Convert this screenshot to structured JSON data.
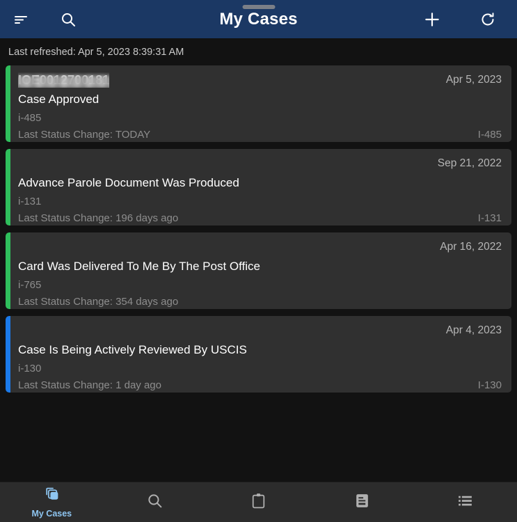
{
  "appbar": {
    "title": "My Cases",
    "sort_icon": "sort-icon",
    "search_icon": "search-icon",
    "add_icon": "plus-icon",
    "refresh_icon": "refresh-icon"
  },
  "refreshed": {
    "text": "Last refreshed: Apr 5, 2023 8:39:31 AM"
  },
  "colors": {
    "appbar_bg": "#1b3864",
    "page_bg": "#121212",
    "card_bg": "#303030",
    "accent_green": "#2fbf5c",
    "accent_blue": "#1b7aea",
    "active_nav": "#8ec5f0"
  },
  "cards": [
    {
      "case_number": "IOE0012700181",
      "redacted": true,
      "redact_width": 160,
      "date": "Apr 5, 2023",
      "status": "Case Approved",
      "form": "i-485",
      "last_status_change": "Last Status Change: TODAY",
      "form_right": "I-485",
      "accent": "#2fbf5c"
    },
    {
      "case_number": "",
      "redacted": true,
      "redact_width": 150,
      "date": "Sep 21, 2022",
      "status": "Advance Parole Document Was Produced",
      "form": "i-131",
      "last_status_change": "Last Status Change: 196 days ago",
      "form_right": "I-131",
      "accent": "#2fbf5c"
    },
    {
      "case_number": "",
      "redacted": true,
      "redact_width": 155,
      "date": "Apr 16, 2022",
      "status": "Card Was Delivered To Me By The Post Office",
      "form": "i-765",
      "last_status_change": "Last Status Change: 354 days ago",
      "form_right": "",
      "accent": "#2fbf5c"
    },
    {
      "case_number": "",
      "redacted": true,
      "redact_width": 160,
      "date": "Apr 4, 2023",
      "status": "Case Is Being Actively Reviewed By USCIS",
      "form": "i-130",
      "last_status_change": "Last Status Change: 1 day ago",
      "form_right": "I-130",
      "accent": "#1b7aea"
    }
  ],
  "bottomnav": {
    "items": [
      {
        "label": "My Cases",
        "icon": "cards-stack-icon",
        "active": true
      },
      {
        "label": "",
        "icon": "search-icon",
        "active": false
      },
      {
        "label": "",
        "icon": "clipboard-icon",
        "active": false
      },
      {
        "label": "",
        "icon": "document-icon",
        "active": false
      },
      {
        "label": "",
        "icon": "list-icon",
        "active": false
      }
    ]
  }
}
